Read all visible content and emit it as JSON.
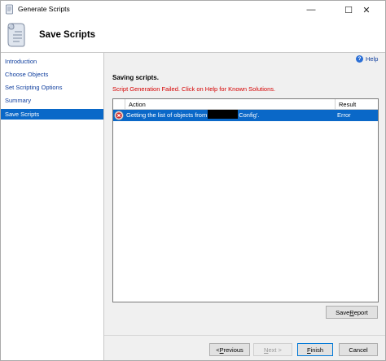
{
  "window": {
    "title": "Generate Scripts",
    "controls": {
      "minimize": "—",
      "maximize": "☐",
      "close": "✕"
    }
  },
  "header": {
    "title": "Save Scripts",
    "icon": "scroll-icon"
  },
  "nav": {
    "items": [
      {
        "label": "Introduction",
        "selected": false
      },
      {
        "label": "Choose Objects",
        "selected": false
      },
      {
        "label": "Set Scripting Options",
        "selected": false
      },
      {
        "label": "Summary",
        "selected": false
      },
      {
        "label": "Save Scripts",
        "selected": true
      }
    ]
  },
  "help": {
    "label": "Help",
    "icon": "help-icon"
  },
  "status": {
    "heading": "Saving scripts.",
    "error_message": "Script Generation Failed. Click on Help for Known Solutions.",
    "error_color": "#d60000"
  },
  "grid": {
    "columns": {
      "action": "Action",
      "result": "Result"
    },
    "rows": [
      {
        "action_prefix": "Getting the list of objects from",
        "action_suffix": "Config'.",
        "result": "Error",
        "icon": "error-icon"
      }
    ]
  },
  "buttons": {
    "save_report": {
      "pre": "Save ",
      "key": "R",
      "post": "eport"
    },
    "previous": {
      "pre": "< ",
      "key": "P",
      "post": "revious"
    },
    "next": {
      "pre": "",
      "key": "N",
      "post": "ext >"
    },
    "finish": {
      "pre": "",
      "key": "F",
      "post": "inish"
    },
    "cancel": {
      "pre": "Cancel",
      "key": "",
      "post": ""
    }
  },
  "colors": {
    "selection": "#0a68c8",
    "link": "#0f3e9e"
  }
}
